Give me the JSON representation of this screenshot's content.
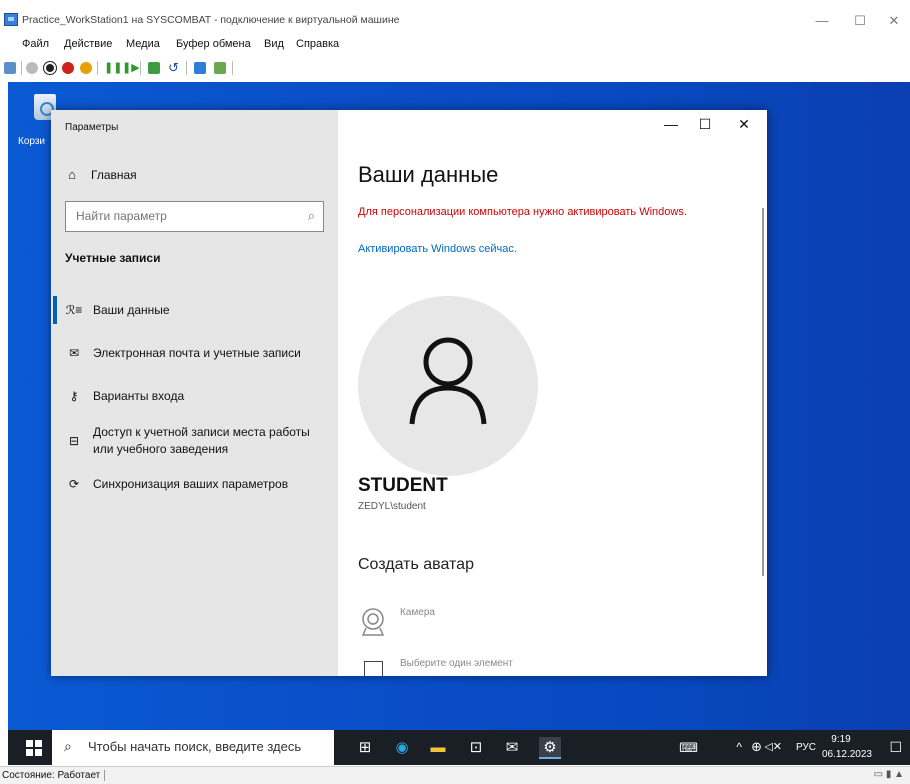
{
  "host": {
    "title": "Practice_WorkStation1 на SYSCOMBAT - подключение к виртуальной машине",
    "controls": [
      "—",
      "☐",
      "✕"
    ],
    "menu": [
      "Файл",
      "Действие",
      "Медиа",
      "Буфер обмена",
      "Вид",
      "Справка"
    ],
    "status": "Состояние: Работает"
  },
  "desktop": {
    "recycle_label": "Корзи"
  },
  "settings": {
    "window_title": "Параметры",
    "home_label": "Главная",
    "search_placeholder": "Найти параметр",
    "section_title": "Учетные записи",
    "nav": [
      {
        "icon": "person-list-icon",
        "glyph": "ℛ≡",
        "label": "Ваши данные",
        "active": true
      },
      {
        "icon": "mail-icon",
        "glyph": "✉",
        "label": "Электронная почта и учетные записи"
      },
      {
        "icon": "key-icon",
        "glyph": "⚷",
        "label": "Варианты входа"
      },
      {
        "icon": "briefcase-icon",
        "glyph": "⊟",
        "label": "Доступ к учетной записи места работы или учебного заведения"
      },
      {
        "icon": "sync-icon",
        "glyph": "⟳",
        "label": "Синхронизация ваших параметров"
      }
    ],
    "window_controls": [
      "—",
      "☐",
      "✕"
    ],
    "page_title": "Ваши данные",
    "activation_warning": "Для персонализации компьютера нужно активировать Windows.",
    "activate_link": "Активировать Windows сейчас.",
    "user_name": "STUDENT",
    "user_domain": "ZEDYL\\student",
    "create_avatar_title": "Создать аватар",
    "camera_label": "Камера",
    "pick_label": "Выберите один элемент"
  },
  "taskbar": {
    "search_placeholder": "Чтобы начать поиск, введите здесь",
    "language": "РУС",
    "time": "9:19",
    "date": "06.12.2023"
  },
  "colors": {
    "accent": "#0063b1",
    "warning": "#d10000",
    "link": "#0067c0",
    "desktop": "#0a4ec8"
  }
}
